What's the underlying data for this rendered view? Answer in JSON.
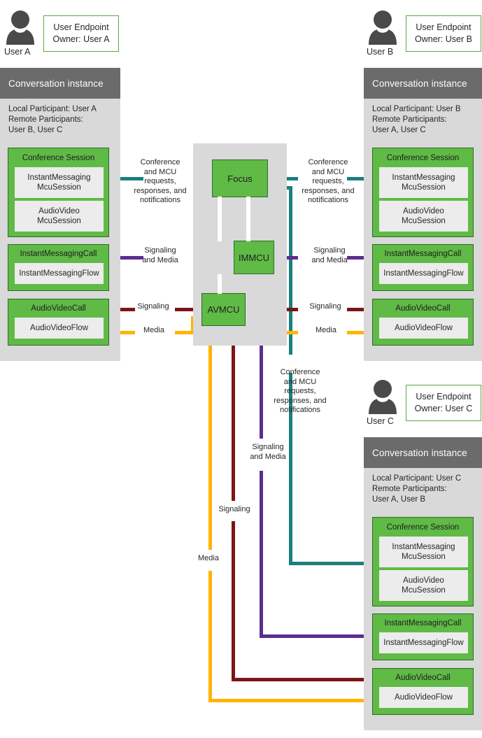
{
  "diagram": {
    "title": "Conference topology: three user endpoints connected through Focus, IMMCU and AVMCU",
    "colors": {
      "green_fill": "#60ba46",
      "green_border": "#2f6b28",
      "panel_gray": "#d9d9d9",
      "header_gray": "#6b6b6b",
      "subbox_gray": "#ececec",
      "teal": "#1b7f7e",
      "purple": "#5b2d90",
      "dark_red": "#7b1518",
      "amber": "#ffb400"
    }
  },
  "users": [
    {
      "id": "a",
      "icon": "person-icon",
      "name": "User A",
      "endpoint": "User Endpoint\nOwner: User A",
      "conversation": {
        "header": "Conversation instance",
        "participants": "Local Participant: User A\nRemote Participants:\nUser B, User C",
        "conference_session": {
          "title": "Conference Session",
          "sessions": [
            "InstantMessaging\nMcuSession",
            "AudioVideo\nMcuSession"
          ]
        },
        "im_call": {
          "title": "InstantMessagingCall",
          "flow": "InstantMessagingFlow"
        },
        "av_call": {
          "title": "AudioVideoCall",
          "flow": "AudioVideoFlow"
        }
      }
    },
    {
      "id": "b",
      "icon": "person-icon",
      "name": "User B",
      "endpoint": "User Endpoint\nOwner: User B",
      "conversation": {
        "header": "Conversation instance",
        "participants": "Local Participant: User B\nRemote Participants:\nUser A, User C",
        "conference_session": {
          "title": "Conference Session",
          "sessions": [
            "InstantMessaging\nMcuSession",
            "AudioVideo\nMcuSession"
          ]
        },
        "im_call": {
          "title": "InstantMessagingCall",
          "flow": "InstantMessagingFlow"
        },
        "av_call": {
          "title": "AudioVideoCall",
          "flow": "AudioVideoFlow"
        }
      }
    },
    {
      "id": "c",
      "icon": "person-icon",
      "name": "User C",
      "endpoint": "User Endpoint\nOwner: User C",
      "conversation": {
        "header": "Conversation instance",
        "participants": "Local Participant: User C\nRemote Participants:\nUser A, User B",
        "conference_session": {
          "title": "Conference Session",
          "sessions": [
            "InstantMessaging\nMcuSession",
            "AudioVideo\nMcuSession"
          ]
        },
        "im_call": {
          "title": "InstantMessagingCall",
          "flow": "InstantMessagingFlow"
        },
        "av_call": {
          "title": "AudioVideoCall",
          "flow": "AudioVideoFlow"
        }
      }
    }
  ],
  "servers": [
    {
      "id": "focus",
      "label": "Focus"
    },
    {
      "id": "immcu",
      "label": "IMMCU"
    },
    {
      "id": "avmcu",
      "label": "AVMCU"
    }
  ],
  "edge_labels": {
    "conference_mcu_left": "Conference\nand MCU\nrequests,\nresponses, and\nnotifications",
    "conference_mcu_right": "Conference\nand MCU\nrequests,\nresponses, and\nnotifications",
    "conference_mcu_bottom": "Conference\nand MCU\nrequests,\nresponses, and\nnotifications",
    "signaling_media_left": "Signaling\nand Media",
    "signaling_media_right": "Signaling\nand Media",
    "signaling_media_bottom": "Signaling\nand Media",
    "signaling_left": "Signaling",
    "signaling_right": "Signaling",
    "signaling_bottom": "Signaling",
    "media_left": "Media",
    "media_right": "Media",
    "media_bottom": "Media"
  }
}
